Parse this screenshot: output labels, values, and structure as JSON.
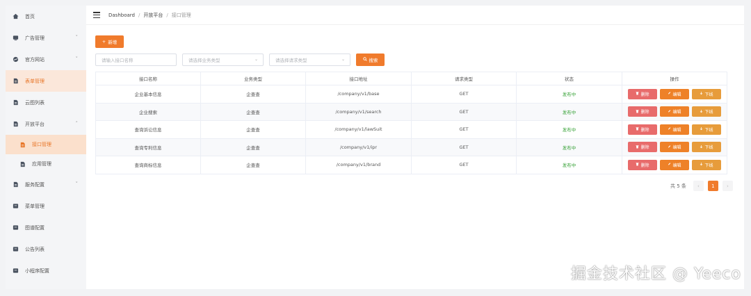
{
  "colors": {
    "accent": "#f07b2c",
    "delete": "#e86b6b",
    "edit": "#ee8128",
    "offline": "#e79c3b",
    "status_green": "#3aa33a",
    "sidebar_active": "#fbe0cc"
  },
  "sidebar": {
    "items": [
      {
        "label": "首页",
        "icon": "home-icon"
      },
      {
        "label": "广告管理",
        "icon": "ad-icon",
        "chevron": "˅"
      },
      {
        "label": "官方网站",
        "icon": "globe-icon",
        "chevron": "˅"
      },
      {
        "label": "表单管理",
        "icon": "form-icon"
      },
      {
        "label": "云图列表",
        "icon": "image-icon"
      },
      {
        "label": "开放平台",
        "icon": "doc-icon",
        "chevron": "˄"
      },
      {
        "label": "接口管理",
        "icon": "doc-icon"
      },
      {
        "label": "应用管理",
        "icon": "doc-icon"
      },
      {
        "label": "服务配置",
        "icon": "doc-icon",
        "chevron": "˅"
      },
      {
        "label": "菜单管理",
        "icon": "menu-icon"
      },
      {
        "label": "图谱配置",
        "icon": "chart-icon"
      },
      {
        "label": "公告列表",
        "icon": "notice-icon"
      },
      {
        "label": "小程序配置",
        "icon": "app-icon"
      }
    ]
  },
  "breadcrumb": {
    "items": [
      "Dashboard",
      "开放平台",
      "接口管理"
    ],
    "separator": "/"
  },
  "toolbar": {
    "add_label": "新增",
    "add_icon": "+"
  },
  "filters": {
    "name_placeholder": "请输入接口名称",
    "business_placeholder": "请选择业务类型",
    "method_placeholder": "请选择请求类型",
    "search_label": "搜索"
  },
  "table": {
    "headers": [
      "接口名称",
      "业务类型",
      "接口地址",
      "请求类型",
      "状态",
      "操作"
    ],
    "rows": [
      {
        "name": "企业基本信息",
        "type": "企查查",
        "url": "/company/v1/base",
        "method": "GET",
        "status": "发布中"
      },
      {
        "name": "企业搜索",
        "type": "企查查",
        "url": "/company/v1/search",
        "method": "GET",
        "status": "发布中"
      },
      {
        "name": "查询诉讼信息",
        "type": "企查查",
        "url": "/company/v1/lawSuit",
        "method": "GET",
        "status": "发布中"
      },
      {
        "name": "查询专利信息",
        "type": "企查查",
        "url": "/company/v1/ipr",
        "method": "GET",
        "status": "发布中"
      },
      {
        "name": "查询商标信息",
        "type": "企查查",
        "url": "/company/v1/brand",
        "method": "GET",
        "status": "发布中"
      }
    ],
    "actions": {
      "delete": "删除",
      "edit": "编辑",
      "offline": "下线"
    }
  },
  "pagination": {
    "total_text": "共 5 条",
    "current_page": "1",
    "prev": "‹",
    "next": "›"
  },
  "watermark": "掘金技术社区 @ Yeeco"
}
